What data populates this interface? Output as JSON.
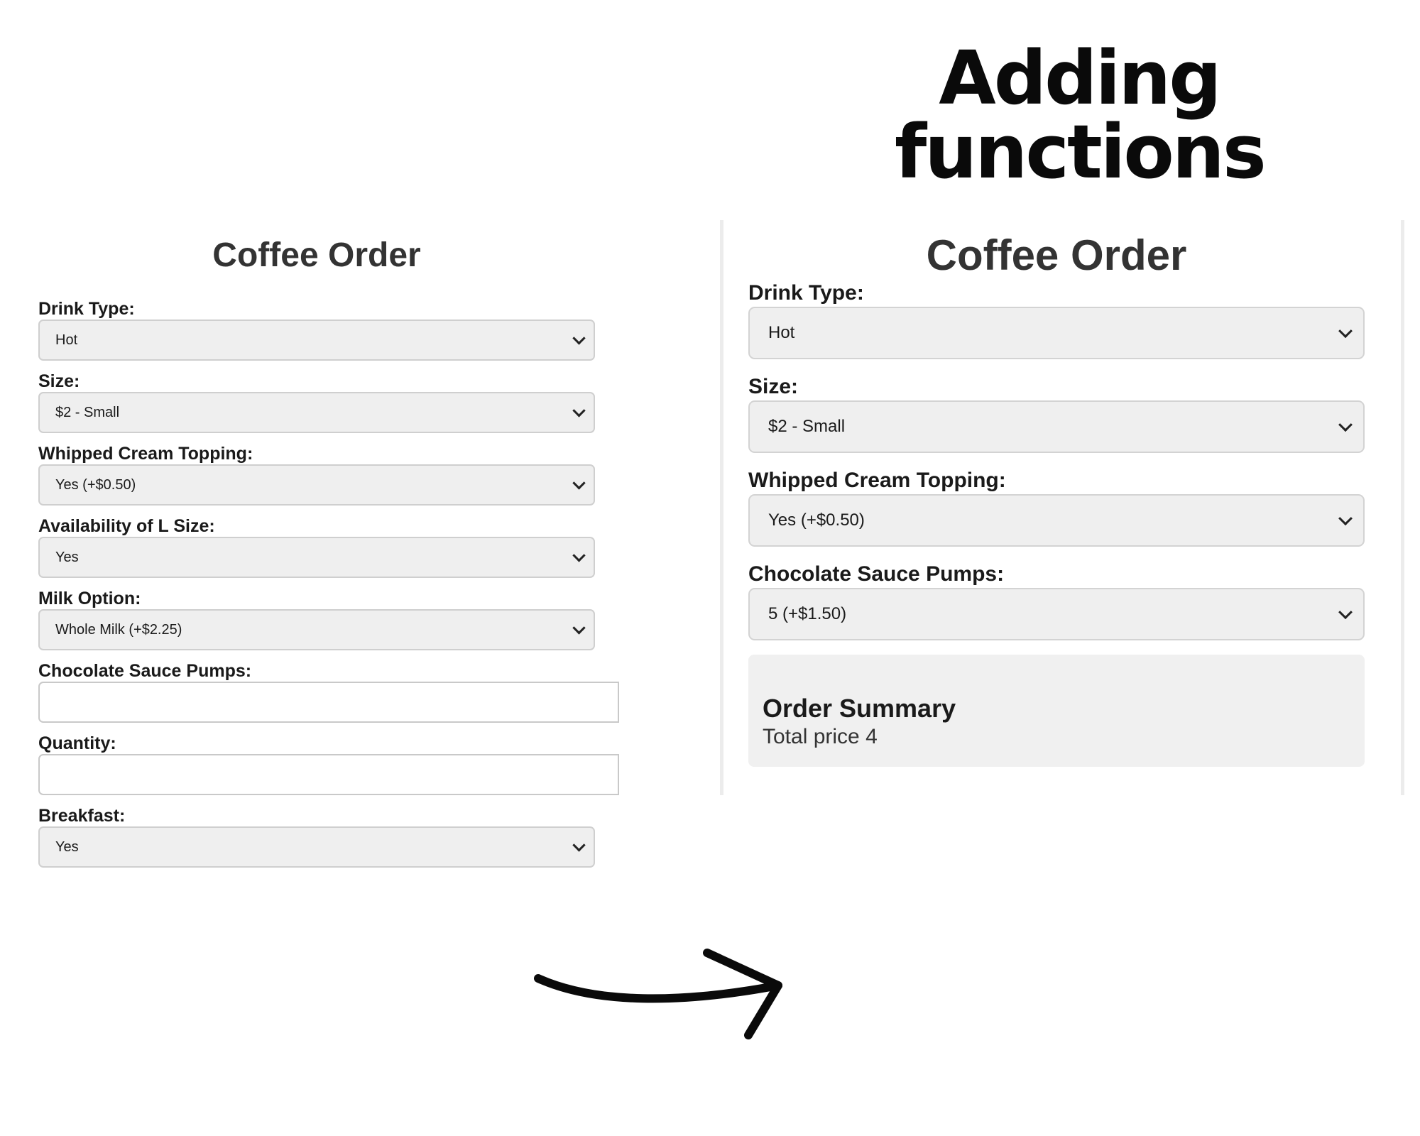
{
  "headline": {
    "line1": "Adding",
    "line2": "functions"
  },
  "before_form": {
    "title": "Coffee Order",
    "fields": {
      "drink_type": {
        "label": "Drink Type:",
        "value": "Hot"
      },
      "size": {
        "label": "Size:",
        "value": "$2 - Small"
      },
      "whipped_cream": {
        "label": "Whipped Cream Topping:",
        "value": "Yes (+$0.50)"
      },
      "l_size": {
        "label": "Availability of L Size:",
        "value": "Yes"
      },
      "milk": {
        "label": "Milk Option:",
        "value": "Whole Milk (+$2.25)"
      },
      "chocolate": {
        "label": "Chocolate Sauce Pumps:",
        "value": ""
      },
      "quantity": {
        "label": "Quantity:",
        "value": ""
      },
      "breakfast": {
        "label": "Breakfast:",
        "value": "Yes"
      }
    }
  },
  "after_form": {
    "title": "Coffee Order",
    "fields": {
      "drink_type": {
        "label": "Drink Type:",
        "value": "Hot"
      },
      "size": {
        "label": "Size:",
        "value": "$2 - Small"
      },
      "whipped_cream": {
        "label": "Whipped Cream Topping:",
        "value": "Yes (+$0.50)"
      },
      "chocolate": {
        "label": "Chocolate Sauce Pumps:",
        "value": "5 (+$1.50)"
      }
    },
    "summary": {
      "title": "Order Summary",
      "text": "Total price 4"
    }
  },
  "icons": {
    "arrow": "arrow-right-icon",
    "dropdown": "chevron-down-icon"
  }
}
